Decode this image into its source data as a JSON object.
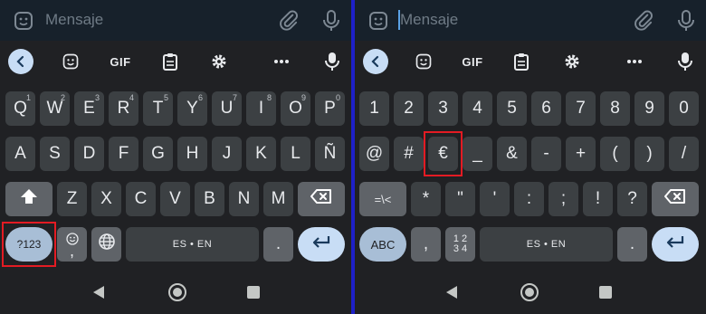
{
  "left": {
    "message_bar": {
      "placeholder": "Mensaje"
    },
    "toolbar": {
      "gif_label": "GIF"
    },
    "rows": {
      "r1": [
        {
          "label": "Q",
          "sub": "1"
        },
        {
          "label": "W",
          "sub": "2"
        },
        {
          "label": "E",
          "sub": "3"
        },
        {
          "label": "R",
          "sub": "4"
        },
        {
          "label": "T",
          "sub": "5"
        },
        {
          "label": "Y",
          "sub": "6"
        },
        {
          "label": "U",
          "sub": "7"
        },
        {
          "label": "I",
          "sub": "8"
        },
        {
          "label": "O",
          "sub": "9"
        },
        {
          "label": "P",
          "sub": "0"
        }
      ],
      "r2": [
        "A",
        "S",
        "D",
        "F",
        "G",
        "H",
        "J",
        "K",
        "L",
        "Ñ"
      ],
      "r3": [
        "Z",
        "X",
        "C",
        "V",
        "B",
        "N",
        "M"
      ]
    },
    "bottom": {
      "symbols_label": "?123",
      "space_label": "ES • EN",
      "period": "."
    }
  },
  "right": {
    "message_bar": {
      "placeholder": "Mensaje"
    },
    "toolbar": {
      "gif_label": "GIF"
    },
    "rows": {
      "r1": [
        "1",
        "2",
        "3",
        "4",
        "5",
        "6",
        "7",
        "8",
        "9",
        "0"
      ],
      "r2": [
        "@",
        "#",
        "€",
        "_",
        "&",
        "-",
        "+",
        "(",
        ")",
        "/"
      ],
      "r3": [
        "*",
        "\"",
        "'",
        ":",
        ";",
        "!",
        "?"
      ]
    },
    "more_symbols_label": "=\\<",
    "bottom": {
      "abc_label": "ABC",
      "comma": ",",
      "fraction_top": "1 2",
      "fraction_bottom": "3 4",
      "space_label": "ES • EN",
      "period": "."
    }
  },
  "colors": {
    "divider": "#1e20c8",
    "highlight": "#e31b23",
    "accent": "#c8ddf5"
  },
  "icons": [
    "sticker-icon",
    "paperclip-icon",
    "microphone-icon",
    "back-chevron-icon",
    "clipboard-icon",
    "gear-icon",
    "more-icon",
    "shift-icon",
    "backspace-icon",
    "emoji-icon",
    "globe-icon",
    "enter-icon",
    "nav-back-icon",
    "nav-home-icon",
    "nav-recents-icon"
  ]
}
